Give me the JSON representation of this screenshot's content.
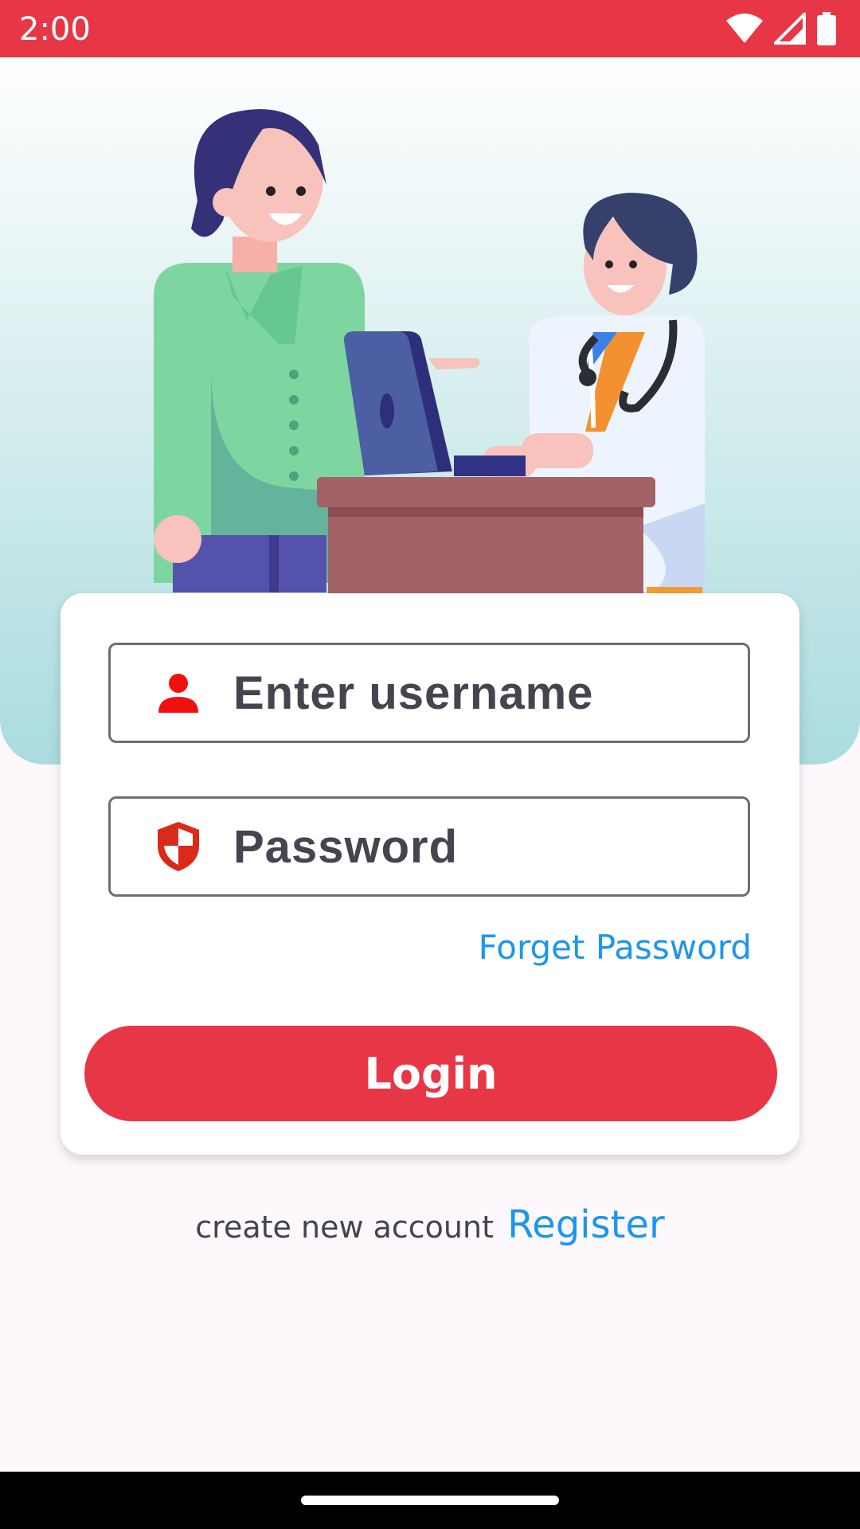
{
  "status_bar": {
    "time": "2:00",
    "icons": [
      "wifi-icon",
      "signal-icon",
      "battery-icon"
    ]
  },
  "hero": {
    "illustration": "patient-and-doctor-illustration"
  },
  "login_form": {
    "username": {
      "placeholder": "Enter username",
      "icon": "person-icon"
    },
    "password": {
      "placeholder": "Password",
      "icon": "shield-icon"
    },
    "forgot_label": "Forget Password",
    "login_label": "Login"
  },
  "register": {
    "prompt": "create new account",
    "link_label": "Register"
  },
  "colors": {
    "accent": "#e73747",
    "link": "#1e96ea",
    "text": "#45454f"
  }
}
